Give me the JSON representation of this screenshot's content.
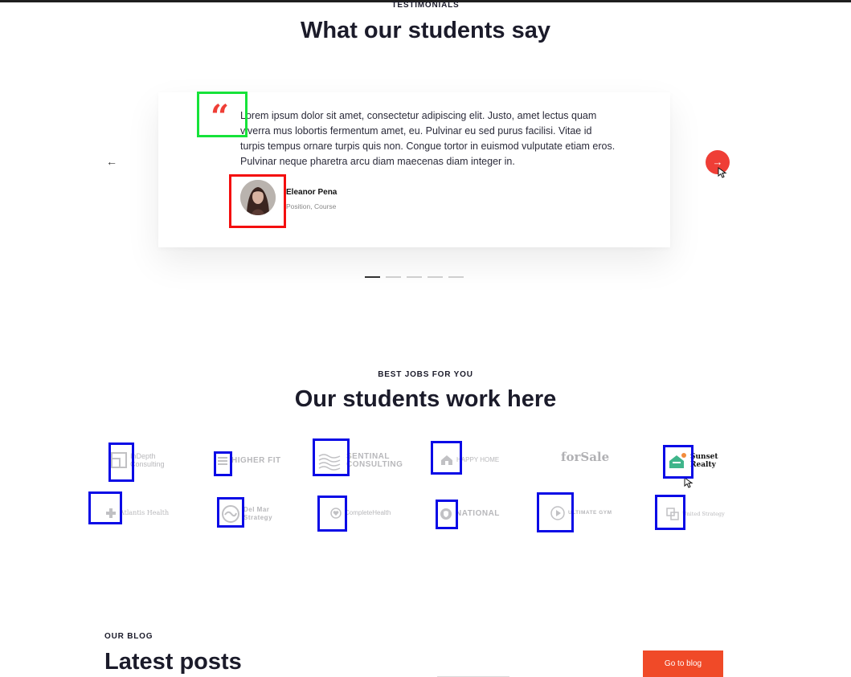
{
  "testimonials": {
    "eyebrow": "TESTIMONIALS",
    "title": "What our students say",
    "quote_glyph": "“",
    "text": "Lorem ipsum dolor sit amet, consectetur adipiscing elit. Justo, amet lectus quam viverra mus lobortis fermentum amet, eu. Pulvinar eu sed purus facilisi. Vitae id turpis tempus ornare turpis quis non. Congue tortor in euismod vulputate etiam eros. Pulvinar neque pharetra arcu diam maecenas diam integer in.",
    "author_name": "Eleanor Pena",
    "author_role": "Position, Course",
    "prev_arrow": "←",
    "next_arrow": "→",
    "slide_count": 5,
    "active_slide": 1
  },
  "jobs": {
    "eyebrow": "BEST JOBS FOR YOU",
    "title": "Our students work here",
    "logos": [
      {
        "name": "In Depth Consulting",
        "lines": [
          "InDepth",
          "Consulting"
        ],
        "icon": "square-corner-icon"
      },
      {
        "name": "Higher Fit",
        "lines": [
          "HIGHER FIT"
        ],
        "icon": "bars-icon"
      },
      {
        "name": "Sentinal Consulting",
        "lines": [
          "SENTINAL",
          "CONSULTING"
        ],
        "icon": "waves-icon"
      },
      {
        "name": "Happy Home",
        "lines": [
          "HAPPY HOME"
        ],
        "icon": "house-icon"
      },
      {
        "name": "For Sale",
        "lines": [
          "forSale"
        ],
        "icon": "sign-icon"
      },
      {
        "name": "Sunset Realty",
        "lines": [
          "Sunset",
          "Realty"
        ],
        "icon": "house-sun-icon"
      },
      {
        "name": "Atlantis Health",
        "lines": [
          "Atlantis Health"
        ],
        "icon": "cross-icon"
      },
      {
        "name": "Del Mar Strategy",
        "lines": [
          "Del Mar",
          "Strategy"
        ],
        "icon": "swirl-icon"
      },
      {
        "name": "Complete Health",
        "lines": [
          "CompleteHealth"
        ],
        "icon": "heart-circle-icon"
      },
      {
        "name": "National",
        "lines": [
          "NATIONAL"
        ],
        "icon": "shield-icon"
      },
      {
        "name": "Ultimate Gym",
        "lines": [
          "ULTIMATE GYM"
        ],
        "icon": "play-circle-icon"
      },
      {
        "name": "United Strategy",
        "lines": [
          "United Strategy"
        ],
        "icon": "squares-icon"
      }
    ]
  },
  "blog": {
    "eyebrow": "OUR BLOG",
    "title": "Latest posts",
    "button_label": "Go to blog"
  },
  "colors": {
    "accent": "#ef3e36",
    "button": "#f04a28",
    "highlight_blue": "#0a0ae6",
    "highlight_green": "#16e33a",
    "highlight_red": "#f40e0e",
    "sunset_green": "#3fb58a",
    "sunset_orange": "#f28c3b"
  }
}
